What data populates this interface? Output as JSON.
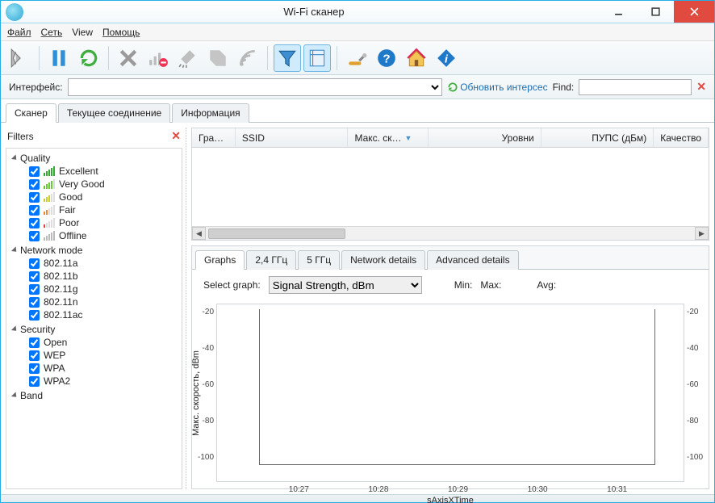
{
  "window": {
    "title": "Wi-Fi сканер"
  },
  "menu": {
    "file": "Файл",
    "net": "Сеть",
    "view": "View",
    "help": "Помощь"
  },
  "interface": {
    "label": "Интерфейс:",
    "refresh": "Обновить интерсес",
    "find_label": "Find:"
  },
  "main_tabs": {
    "scanner": "Сканер",
    "conn": "Текущее соединение",
    "info": "Информация"
  },
  "filters": {
    "title": "Filters",
    "groups": {
      "quality": {
        "label": "Quality",
        "items": [
          "Excellent",
          "Very Good",
          "Good",
          "Fair",
          "Poor",
          "Offline"
        ]
      },
      "mode": {
        "label": "Network mode",
        "items": [
          "802.11a",
          "802.11b",
          "802.11g",
          "802.11n",
          "802.11ac"
        ]
      },
      "security": {
        "label": "Security",
        "items": [
          "Open",
          "WEP",
          "WPA",
          "WPA2"
        ]
      },
      "band": {
        "label": "Band"
      }
    }
  },
  "grid": {
    "cols": {
      "graph": "Гра…",
      "ssid": "SSID",
      "maxsp": "Макс. ск…",
      "levels": "Уровни",
      "pups": "ПУПС (дБм)",
      "quality": "Качество"
    }
  },
  "lower_tabs": {
    "graphs": "Graphs",
    "g24": "2,4 ГГц",
    "g5": "5 ГГц",
    "netd": "Network details",
    "adv": "Advanced details"
  },
  "graph": {
    "select_label": "Select graph:",
    "select_value": "Signal Strength, dBm",
    "min": "Min:",
    "max": "Max:",
    "avg": "Avg:"
  },
  "chart_data": {
    "type": "line",
    "title": "",
    "ylabel": "Макс. скорость, dBm",
    "xlabel": "sAxisXTime",
    "ylim": [
      -100,
      -20
    ],
    "yticks": [
      -20,
      -40,
      -60,
      -80,
      -100
    ],
    "categories": [
      "10:27",
      "10:28",
      "10:29",
      "10:30",
      "10:31"
    ],
    "series": []
  }
}
